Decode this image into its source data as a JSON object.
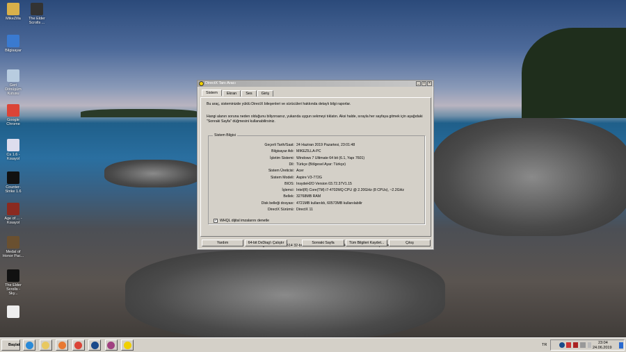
{
  "desktop": {
    "icons": [
      {
        "label": "MikeZilla",
        "color": "#d8b04a"
      },
      {
        "label": "The Elder Scrolls ...",
        "color": "#333"
      },
      {
        "label": "Bilgisayar",
        "color": "#3a7ad0"
      },
      {
        "label": "Geri Dönüşüm Kutusu",
        "color": "#b8cce0"
      },
      {
        "label": "Google Chrome",
        "color": "#db4437"
      },
      {
        "label": "Cs 1.6 - Kısayol",
        "color": "#dde"
      },
      {
        "label": "Counter-Strike 1.6",
        "color": "#111"
      },
      {
        "label": "Age of ... - Kısayol",
        "color": "#8a2a20"
      },
      {
        "label": "Medal of Honor Pac...",
        "color": "#6a5030"
      },
      {
        "label": "The Elder Scrolls - Sky...",
        "color": "#111"
      },
      {
        "label": "",
        "color": "#eee"
      }
    ]
  },
  "dialog": {
    "title": "DirectX Tanı Aracı",
    "controls": [
      "_",
      "□",
      "×"
    ],
    "tabs": [
      "Sistem",
      "Ekran",
      "Ses",
      "Giriş"
    ],
    "intro1": "Bu araç, sisteminizde yüklü DirectX bileşenleri ve sürücüleri hakkında detaylı bilgi raporlar.",
    "intro2": "Hangi alanın soruna neden olduğunu biliyorsanız, yukarıda uygun sekmeyi tıklatın.  Aksi halde, sırayla her sayfaya gitmek için aşağıdaki",
    "intro3": "\"Sonraki Sayfa\" düğmesini kullanabilirsiniz.",
    "group_title": "Sistem Bilgisi",
    "rows": [
      {
        "k": "Geçerli Tarih/Saat:",
        "v": "24 Haziran 2019 Pazartesi, 23:01:48"
      },
      {
        "k": "Bilgisayar Adı:",
        "v": "MIKEZILLA-PC"
      },
      {
        "k": "İşletim Sistemi:",
        "v": "Windows 7 Ultimate 64 bit (6.1, Yapı 7601)"
      },
      {
        "k": "Dil:",
        "v": "Türkçe (Bölgesel Ayar: Türkçe)"
      },
      {
        "k": "Sistem Üreticisi:",
        "v": "Acer"
      },
      {
        "k": "Sistem Modeli:",
        "v": "Aspire V3-772G"
      },
      {
        "k": "BIOS:",
        "v": "InsydeH2O Version 03.72.37V1.15"
      },
      {
        "k": "İşlemci:",
        "v": "Intel(R) Core(TM) i7-4702MQ CPU @ 2.20GHz (8 CPUs), ~2.2GHz"
      },
      {
        "k": "Bellek:",
        "v": "32768MB RAM"
      },
      {
        "k": "Disk belleği dosyası:",
        "v": "4721MB kullanıldı, 60573MB kullanılabilir"
      },
      {
        "k": "DirectX Sürümü:",
        "v": "DirectX 11"
      }
    ],
    "whql_label": "WHQL dijital imzalarını denetle",
    "whql_checked": true,
    "footer": "DxDiag 6.01.7601.17514 32-bit Unicode  Telif Hakkı © 1998-2006 Microsoft Corporation.  Tüm hakları saklıdır.",
    "buttons": [
      "Yardım",
      "64-bit DxDiag'ı Çalıştır",
      "Sonraki Sayfa",
      "Tüm Bilgileri Kaydet...",
      "Çıkış"
    ]
  },
  "taskbar": {
    "start": "Başlat",
    "apps": [
      {
        "name": "internet-explorer",
        "color": "#2a8ad8"
      },
      {
        "name": "file-explorer",
        "color": "#e8c860"
      },
      {
        "name": "media-player",
        "color": "#e87830"
      },
      {
        "name": "chrome",
        "color": "#db4437"
      },
      {
        "name": "app-g",
        "color": "#1a4a8a"
      },
      {
        "name": "app-rar",
        "color": "#a04080"
      },
      {
        "name": "directx",
        "color": "#f0d000"
      }
    ],
    "lang": "TR",
    "time": "23:04",
    "date": "24.06.2019"
  }
}
